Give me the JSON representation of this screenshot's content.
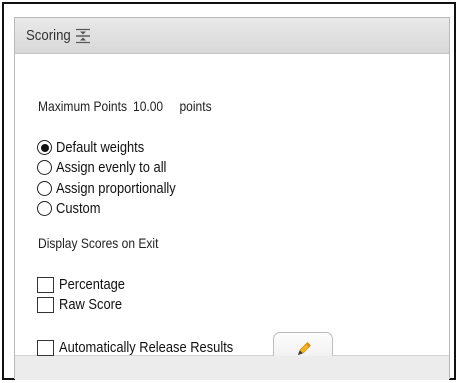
{
  "panel": {
    "title": "Scoring",
    "collapse_icon": "collapse-vertical-icon"
  },
  "maximum_points": {
    "label": "Maximum Points",
    "value": "10.00",
    "unit": "points"
  },
  "weighting": {
    "selected": "Default weights",
    "options": [
      "Default weights",
      "Assign evenly to all",
      "Assign proportionally",
      "Custom"
    ]
  },
  "display_scores": {
    "heading": "Display Scores on Exit",
    "options": [
      {
        "label": "Percentage",
        "checked": false
      },
      {
        "label": "Raw Score",
        "checked": false
      }
    ]
  },
  "release": {
    "label": "Automatically Release Results",
    "checked": false,
    "edit_icon": "pencil-icon"
  },
  "colors": {
    "pencil_body": "#f0b323",
    "pencil_tip": "#3d3d3d",
    "header_bg": "#dedede"
  }
}
